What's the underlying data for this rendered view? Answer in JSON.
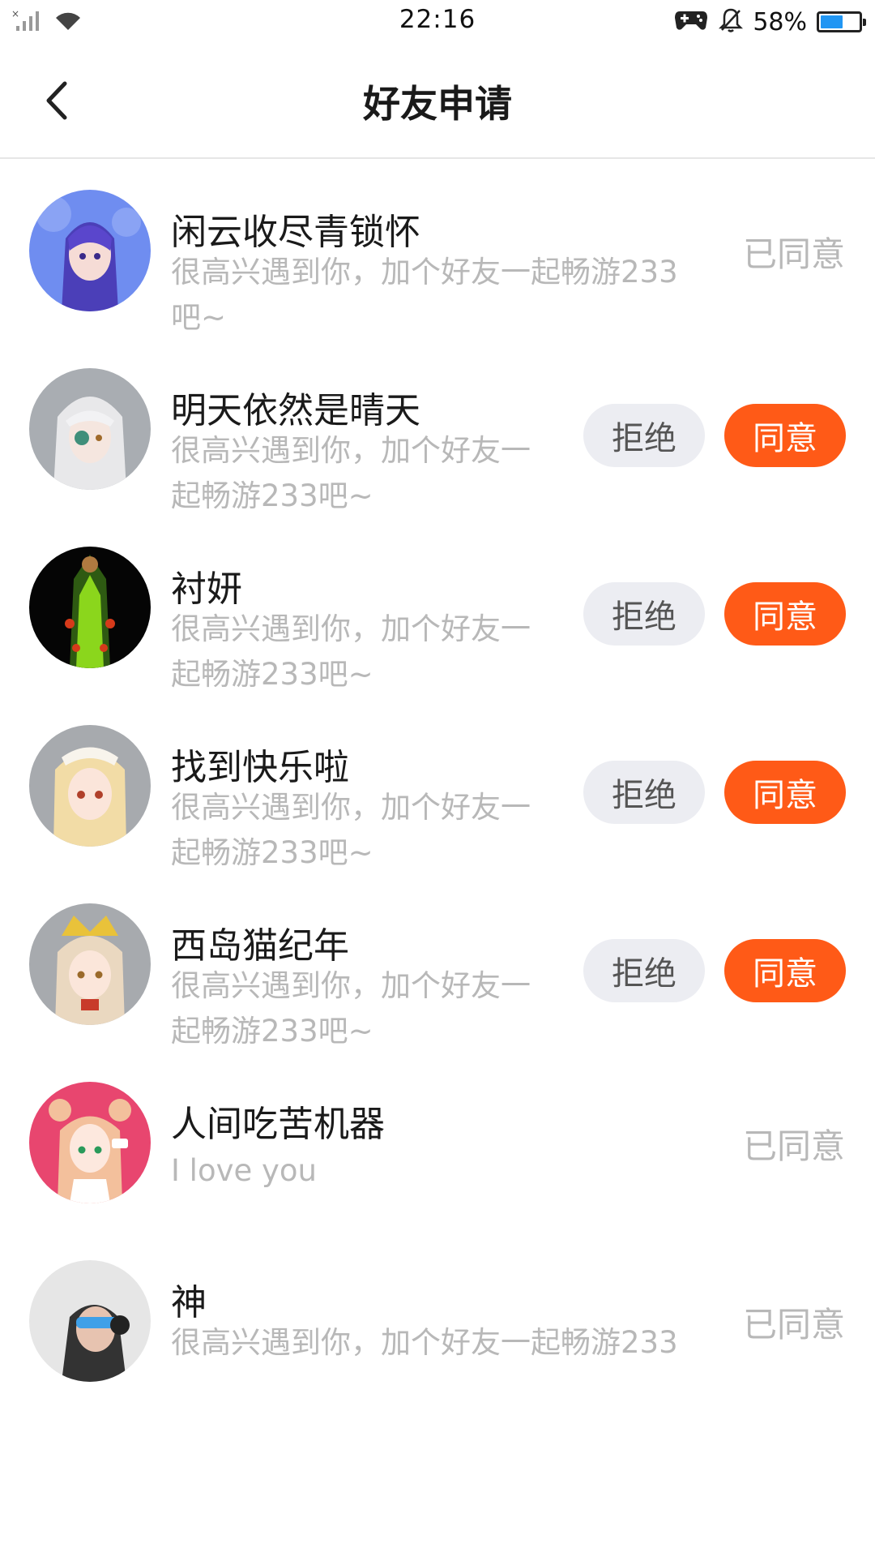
{
  "status_bar": {
    "time": "22:16",
    "battery_percent": "58%",
    "battery_level": 0.58,
    "icons": [
      "signal-icon",
      "wifi-icon",
      "gamepad-icon",
      "notifications-off-icon",
      "battery-icon"
    ]
  },
  "header": {
    "title": "好友申请",
    "back_icon": "chevron-left-icon"
  },
  "buttons": {
    "reject_label": "拒绝",
    "accept_label": "同意",
    "agreed_label": "已同意"
  },
  "requests": [
    {
      "name": "闲云收尽青锁怀",
      "message": "很高兴遇到你，加个好友一起畅游233吧~",
      "status": "agreed"
    },
    {
      "name": "明天依然是晴天",
      "message": "很高兴遇到你，加个好友一起畅游233吧~",
      "status": "pending"
    },
    {
      "name": "衬妍",
      "message": "很高兴遇到你，加个好友一起畅游233吧~",
      "status": "pending"
    },
    {
      "name": "找到快乐啦",
      "message": "很高兴遇到你，加个好友一起畅游233吧~",
      "status": "pending"
    },
    {
      "name": "西岛猫纪年",
      "message": "很高兴遇到你，加个好友一起畅游233吧~",
      "status": "pending"
    },
    {
      "name": "人间吃苦机器",
      "message": "I love you",
      "status": "agreed"
    },
    {
      "name": "神",
      "message": "很高兴遇到你，加个好友一起畅游233",
      "status": "agreed"
    }
  ]
}
